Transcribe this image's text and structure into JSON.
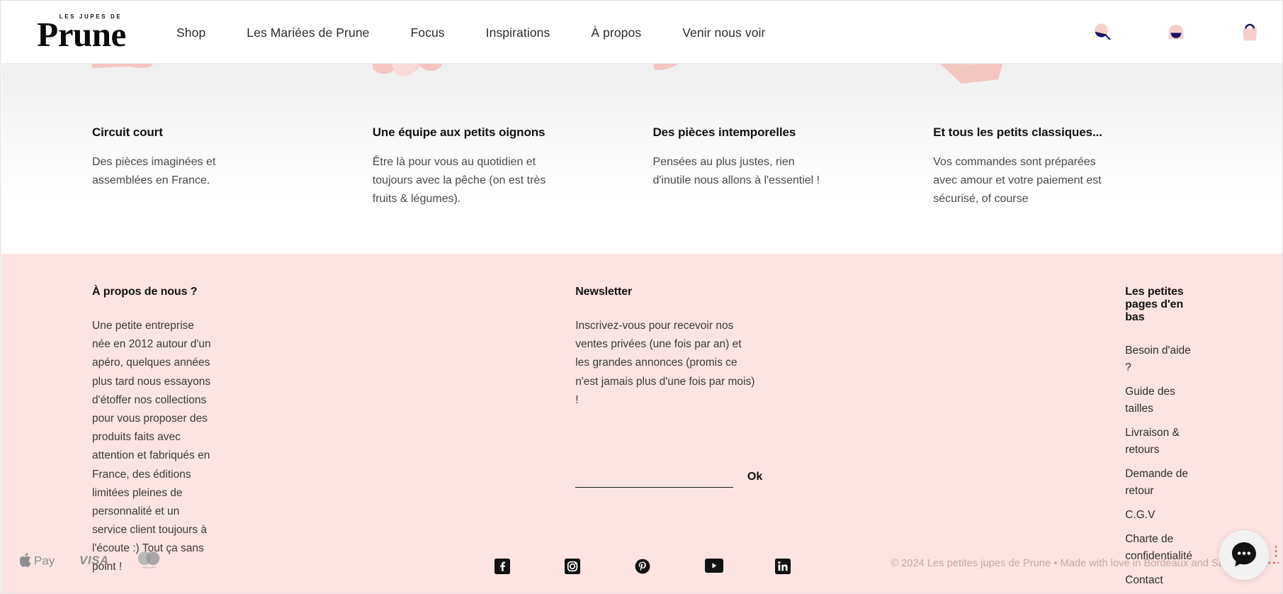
{
  "header": {
    "logo": {
      "kicker": "LES JUPES DE",
      "word": "Prune"
    },
    "nav": [
      {
        "label": "Shop",
        "name": "nav-shop"
      },
      {
        "label": "Les Mariées de Prune",
        "name": "nav-les-mariees-de-prune"
      },
      {
        "label": "Focus",
        "name": "nav-focus"
      },
      {
        "label": "Inspirations",
        "name": "nav-inspirations"
      },
      {
        "label": "À propos",
        "name": "nav-a-propos"
      },
      {
        "label": "Venir nous voir",
        "name": "nav-venir-nous-voir"
      }
    ],
    "actions": [
      {
        "icon": "search-icon",
        "label": "Recherche"
      },
      {
        "icon": "account-icon",
        "label": "Compte"
      },
      {
        "icon": "cart-bag-icon",
        "label": "Panier"
      }
    ]
  },
  "features": [
    {
      "illustration": "hand-icon",
      "title": "Circuit court",
      "text": "Des pièces imaginées et assemblées en France."
    },
    {
      "illustration": "flower-petals-icon",
      "title": "Une équipe aux petits oignons",
      "text": "Être là pour vous au quotidien et toujours avec la pêche (on est très fruits & légumes)."
    },
    {
      "illustration": "thumb-icon",
      "title": "Des pièces intemporelles",
      "text": "Pensées au plus justes, rien d'inutile nous allons à l'essentiel !"
    },
    {
      "illustration": "open-box-icon",
      "title": "Et tous les petits classiques...",
      "text": "Vos commandes sont préparées avec amour et votre paiement est sécurisé, of course"
    }
  ],
  "footer": {
    "about": {
      "heading": "À propos de nous ?",
      "text": "Une petite entreprise née en 2012 autour d'un apéro, quelques années plus tard nous essayons d'étoffer nos collections pour vous proposer des produits faits avec attention et fabriqués en France, des éditions limitées pleines de personnalité et un service client toujours à l'écoute :) Tout ça sans point !"
    },
    "newsletter": {
      "heading": "Newsletter",
      "text": "Inscrivez-vous pour recevoir nos ventes privées (une fois par an) et les grandes annonces (promis ce n'est jamais plus d'une fois par mois) !",
      "input_value": "",
      "input_placeholder": "",
      "submit_label": "Ok"
    },
    "links": {
      "heading": "Les petites pages d'en bas",
      "items": [
        {
          "label": "Besoin d'aide ?",
          "name": "footer-link-besoin-d-aide"
        },
        {
          "label": "Guide des tailles",
          "name": "footer-link-guide-des-tailles"
        },
        {
          "label": "Livraison & retours",
          "name": "footer-link-livraison-retours"
        },
        {
          "label": "Demande de retour",
          "name": "footer-link-demande-de-retour"
        },
        {
          "label": "C.G.V",
          "name": "footer-link-cgv"
        },
        {
          "label": "Charte de confidentialité",
          "name": "footer-link-charte-de-confidentialite"
        },
        {
          "label": "Contact",
          "name": "footer-link-contact"
        }
      ]
    },
    "payments": [
      {
        "icon": "apple-pay-icon",
        "label": "Apple Pay"
      },
      {
        "icon": "visa-icon",
        "label": "VISA"
      },
      {
        "icon": "mastercard-icon",
        "label": "Mastercard"
      }
    ],
    "socials": [
      {
        "icon": "facebook-icon",
        "label": "Facebook"
      },
      {
        "icon": "instagram-icon",
        "label": "Instagram"
      },
      {
        "icon": "pinterest-icon",
        "label": "Pinterest"
      },
      {
        "icon": "youtube-icon",
        "label": "YouTube"
      },
      {
        "icon": "linkedin-icon",
        "label": "LinkedIn"
      }
    ],
    "copyright": "© 2024 Les petites jupes de Prune • Made with love in Bordeaux and Saint-Cloud"
  },
  "chat": {
    "icon": "chat-bubble-icon",
    "label": "Ouvrir le chat"
  },
  "colors": {
    "footer_pink": "#fce4e2",
    "illustration_pink": "#f5ccc8",
    "icon_navy": "#1b1464",
    "text_dark": "#1a1a1a",
    "copyright_muted": "#c9a6a4"
  }
}
